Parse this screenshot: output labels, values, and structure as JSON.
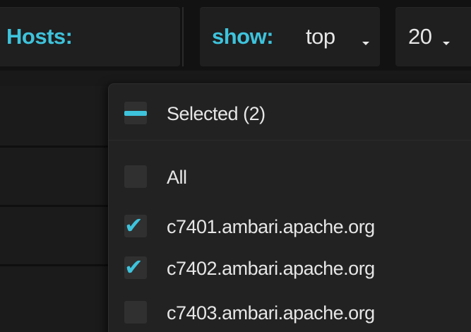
{
  "toolbar": {
    "hosts_label": "Hosts:",
    "show_label": "show:",
    "show_value": "top",
    "count_value": "20"
  },
  "dropdown": {
    "selected_label": "Selected (2)",
    "items": [
      {
        "label": "All",
        "checked": false
      },
      {
        "label": "c7401.ambari.apache.org",
        "checked": true
      },
      {
        "label": "c7402.ambari.apache.org",
        "checked": true
      },
      {
        "label": "c7403.ambari.apache.org",
        "checked": false
      }
    ]
  },
  "colors": {
    "accent": "#3ec3dc",
    "text": "#e6e6e6",
    "panel": "#222222",
    "background": "#191919"
  },
  "icons": {
    "selected_indicator": "minus-icon",
    "checked": "checkmark-icon",
    "caret": "chevron-down-icon"
  }
}
